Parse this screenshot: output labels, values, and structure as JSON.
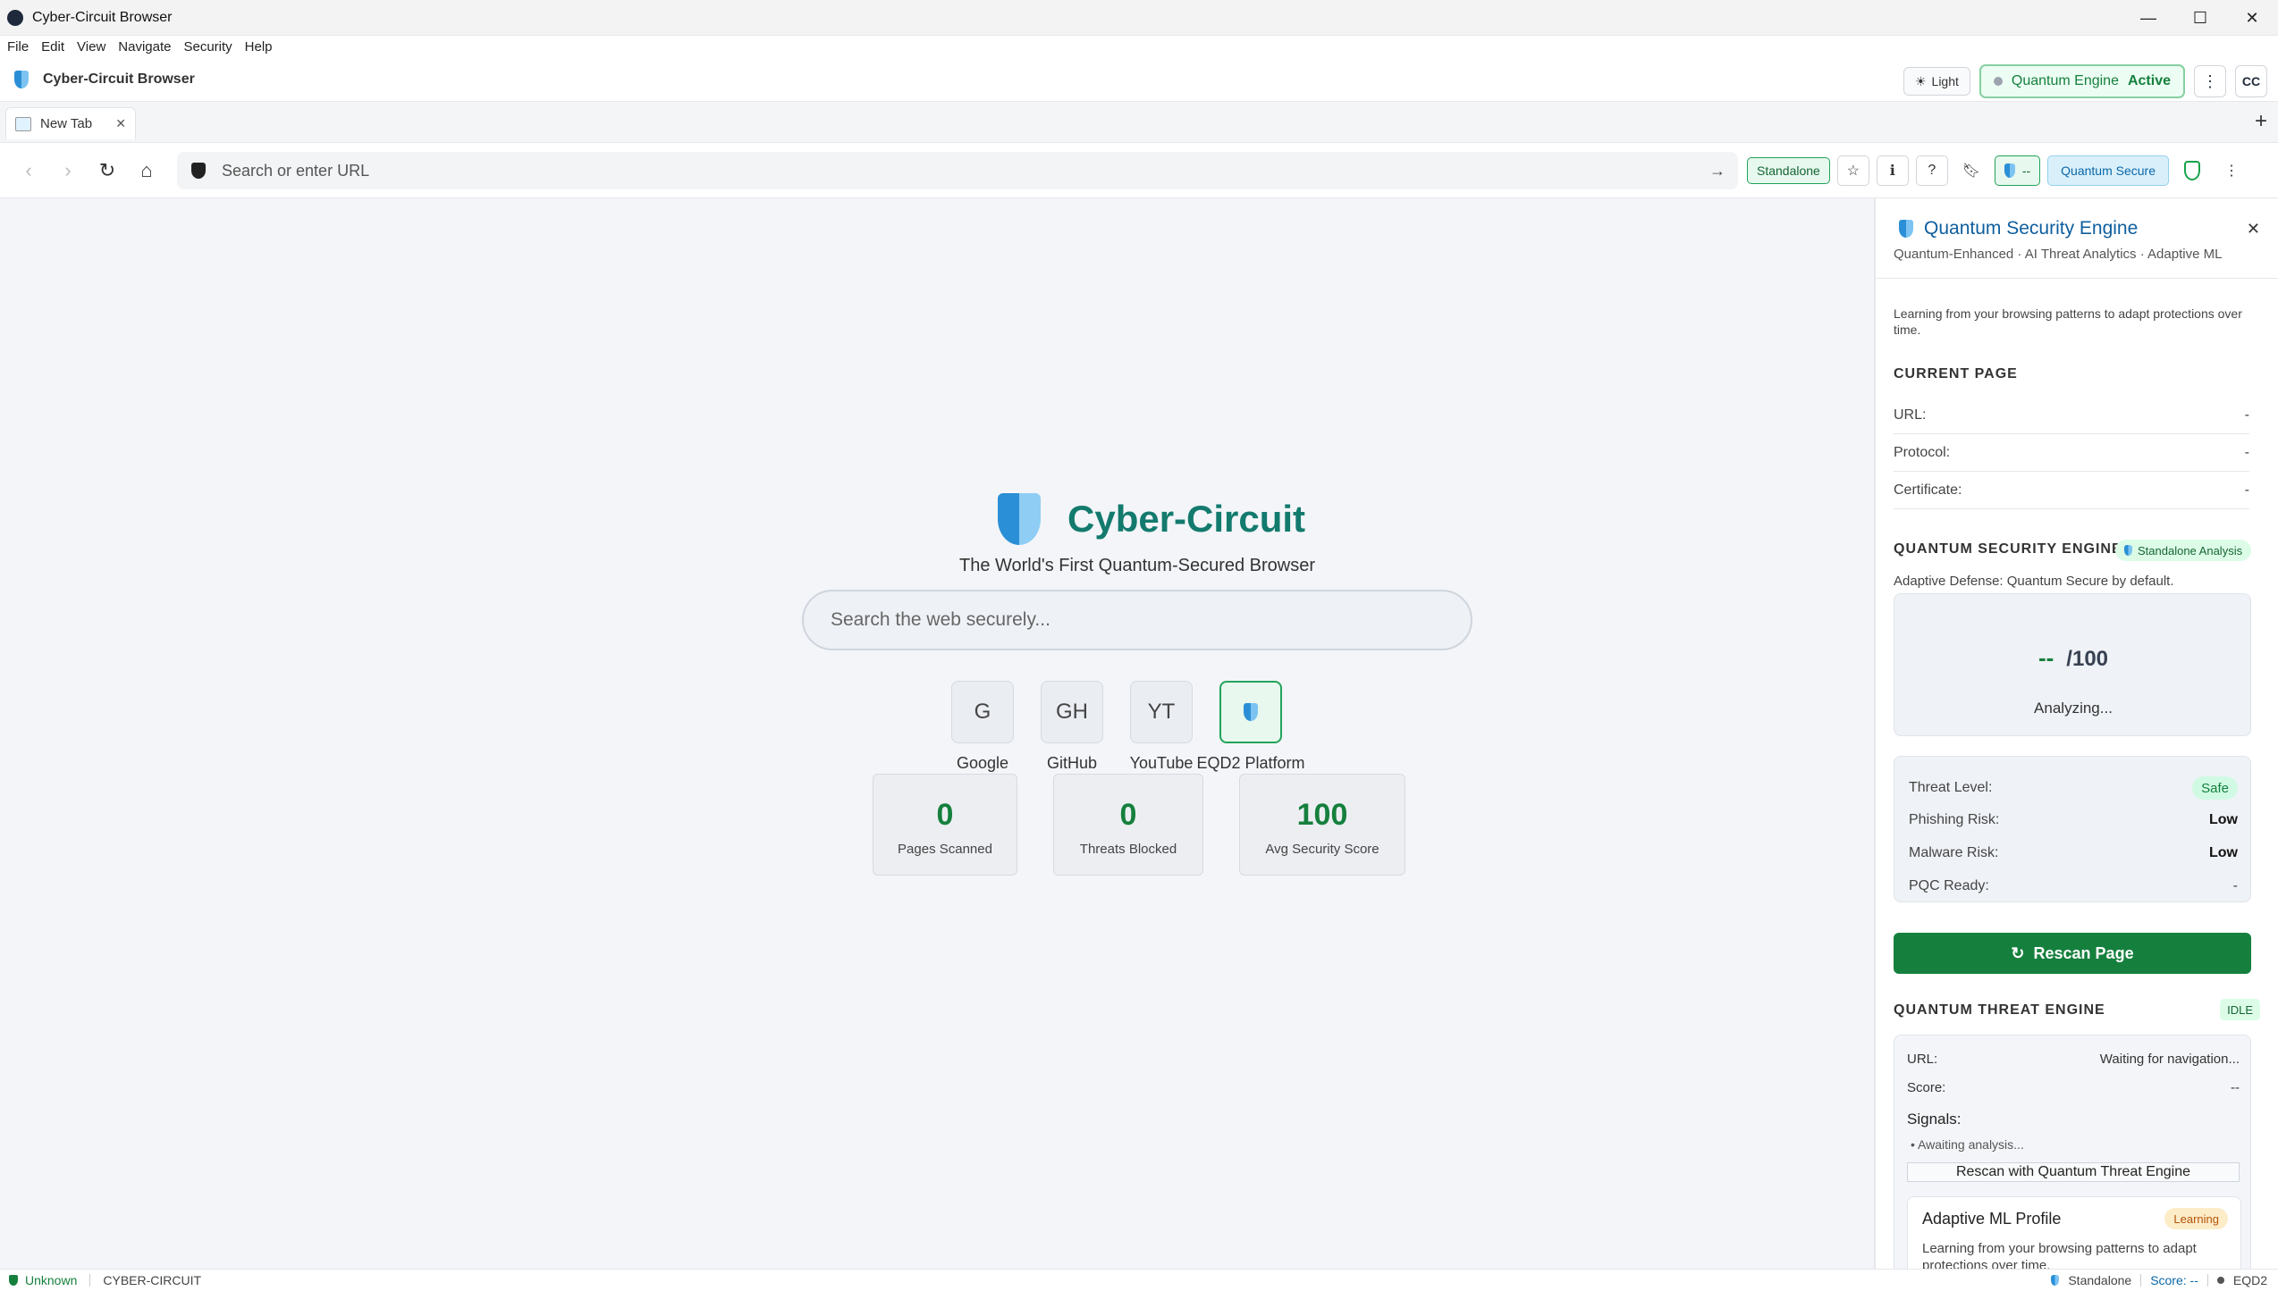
{
  "window": {
    "title": "Cyber-Circuit Browser",
    "controls": [
      "—",
      "☐",
      "✕"
    ]
  },
  "menu": [
    "File",
    "Edit",
    "View",
    "Navigate",
    "Security",
    "Help"
  ],
  "header": {
    "brand": "Cyber-Circuit Browser",
    "theme_label": "Light",
    "engine_label": "Quantum Engine",
    "engine_state": "Active",
    "avatar": "CC"
  },
  "tabs": [
    {
      "label": "New Tab"
    }
  ],
  "toolbar": {
    "url_placeholder": "Search or enter URL",
    "mode_badge": "Standalone",
    "score_pill": "--",
    "secure_badge": "Quantum Secure"
  },
  "home": {
    "brand_title": "Cyber-Circuit",
    "tagline": "The World's First Quantum-Secured Browser",
    "search_placeholder": "Search the web securely...",
    "quick_links": [
      {
        "abbr": "G",
        "label": "Google"
      },
      {
        "abbr": "GH",
        "label": "GitHub"
      },
      {
        "abbr": "YT",
        "label": "YouTube"
      },
      {
        "abbr": "",
        "label": "EQD2 Platform"
      }
    ],
    "stats": [
      {
        "value": "0",
        "label": "Pages Scanned"
      },
      {
        "value": "0",
        "label": "Threats Blocked"
      },
      {
        "value": "100",
        "label": "Avg Security Score"
      }
    ]
  },
  "panel": {
    "title": "Quantum Security Engine",
    "subtitle": "Quantum-Enhanced · AI Threat Analytics · Adaptive ML",
    "note": "Learning from your browsing patterns to adapt protections over time.",
    "current_page": {
      "heading": "CURRENT PAGE",
      "rows": [
        {
          "key": "URL:",
          "value": "-"
        },
        {
          "key": "Protocol:",
          "value": "-"
        },
        {
          "key": "Certificate:",
          "value": "-"
        }
      ]
    },
    "engine": {
      "heading": "QUANTUM SECURITY ENGINE",
      "chip": "Standalone Analysis",
      "adaptive": "Adaptive Defense: Quantum Secure by default.",
      "score": "--",
      "score_max": "/100",
      "state": "Analyzing...",
      "risks": [
        {
          "key": "Threat Level:",
          "value": "Safe"
        },
        {
          "key": "Phishing Risk:",
          "value": "Low"
        },
        {
          "key": "Malware Risk:",
          "value": "Low"
        },
        {
          "key": "PQC Ready:",
          "value": "-"
        }
      ],
      "rescan_label": "Rescan Page"
    },
    "threat_engine": {
      "heading": "QUANTUM THREAT ENGINE",
      "status": "IDLE",
      "url_key": "URL:",
      "url_value": "Waiting for navigation...",
      "score_key": "Score:",
      "score_value": "--",
      "signals_label": "Signals:",
      "signal_item": "Awaiting analysis...",
      "rescan_label": "Rescan with Quantum Threat Engine",
      "ml": {
        "title": "Adaptive ML Profile",
        "badge": "Learning",
        "desc": "Learning from your browsing patterns to adapt protections over time."
      }
    }
  },
  "statusbar": {
    "security": "Unknown",
    "brand": "CYBER-CIRCUIT",
    "mode": "Standalone",
    "score": "Score: --",
    "platform": "EQD2"
  }
}
